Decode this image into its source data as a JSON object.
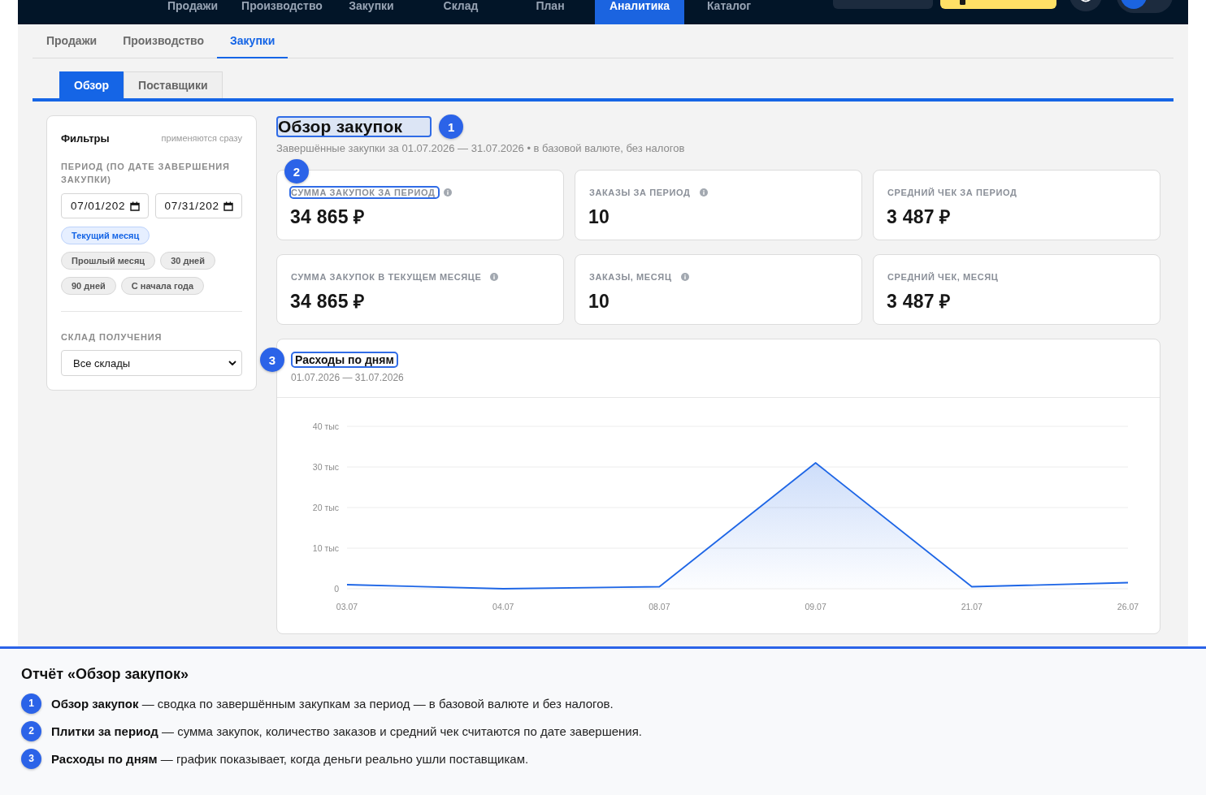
{
  "top_nav": {
    "tabs": [
      {
        "label": "Продажи",
        "selected": false
      },
      {
        "label": "Производство",
        "selected": false
      },
      {
        "label": "Закупки",
        "selected": false
      },
      {
        "label": "Склад",
        "selected": false
      },
      {
        "label": "План",
        "selected": false
      },
      {
        "label": "Аналитика",
        "selected": true
      },
      {
        "label": "Каталог",
        "selected": false
      }
    ]
  },
  "section_tabs": [
    {
      "label": "Продажи",
      "selected": false
    },
    {
      "label": "Производство",
      "selected": false
    },
    {
      "label": "Закупки",
      "selected": true
    }
  ],
  "report_tabs": [
    {
      "label": "Обзор",
      "selected": true
    },
    {
      "label": "Поставщики",
      "selected": false
    }
  ],
  "filters": {
    "title": "Фильтры",
    "hint": "применяются сразу",
    "period_label": "ПЕРИОД (ПО ДАТЕ ЗАВЕРШЕНИЯ ЗАКУПКИ)",
    "date_from": {
      "value": "07/01/202"
    },
    "date_to": {
      "value": "07/31/202"
    },
    "presets": [
      {
        "label": "Текущий месяц",
        "selected": true
      },
      {
        "label": "Прошлый месяц",
        "selected": false
      },
      {
        "label": "30 дней",
        "selected": false
      },
      {
        "label": "90 дней",
        "selected": false
      },
      {
        "label": "С начала года",
        "selected": false
      }
    ],
    "warehouse_label": "СКЛАД ПОЛУЧЕНИЯ",
    "warehouse_select": {
      "value": "Все склады"
    }
  },
  "overview": {
    "title": {
      "text": "Обзор закупок",
      "highlighted": true,
      "marker": "1"
    },
    "subtitle": "Завершённые закупки за 01.07.2026 — 31.07.2026 • в базовой валюте, без налогов",
    "kpis": [
      {
        "label": "СУММА ЗАКУПОК ЗА ПЕРИОД",
        "value": "34 865 ₽",
        "info": true,
        "highlighted": true,
        "marker": "2"
      },
      {
        "label": "ЗАКАЗЫ ЗА ПЕРИОД",
        "value": "10",
        "info": true,
        "highlighted": false
      },
      {
        "label": "СРЕДНИЙ ЧЕК ЗА ПЕРИОД",
        "value": "3 487 ₽",
        "info": false,
        "highlighted": false
      },
      {
        "label": "СУММА ЗАКУПОК В ТЕКУЩЕМ МЕСЯЦЕ",
        "value": "34 865 ₽",
        "info": true,
        "highlighted": false
      },
      {
        "label": "ЗАКАЗЫ, МЕСЯЦ",
        "value": "10",
        "info": true,
        "highlighted": false
      },
      {
        "label": "СРЕДНИЙ ЧЕК, МЕСЯЦ",
        "value": "3 487 ₽",
        "info": false,
        "highlighted": false
      }
    ]
  },
  "spend_chart": {
    "title": {
      "text": "Расходы по дням",
      "highlighted": true,
      "marker": "3"
    },
    "subtitle": "01.07.2026 — 31.07.2026",
    "chart_data": {
      "type": "area",
      "categories": [
        "03.07",
        "04.07",
        "08.07",
        "09.07",
        "21.07",
        "26.07"
      ],
      "values": [
        1,
        0,
        0.5,
        31,
        0.5,
        1.5
      ],
      "ylim": [
        0,
        40
      ],
      "yticks": [
        {
          "value": 0,
          "label": "0"
        },
        {
          "value": 10,
          "label": "10 тыс"
        },
        {
          "value": 20,
          "label": "20 тыс"
        },
        {
          "value": 30,
          "label": "30 тыс"
        },
        {
          "value": 40,
          "label": "40 тыс"
        }
      ],
      "grid": true
    }
  },
  "guide": {
    "title": "Отчёт «Обзор закупок»",
    "items": [
      {
        "number": "1",
        "text": "**Обзор закупок** — сводка по завершённым закупкам за период — в базовой валюте и без налогов."
      },
      {
        "number": "2",
        "text": "**Плитки за период** — сумма закупок, количество заказов и средний чек считаются по дате завершения."
      },
      {
        "number": "3",
        "text": "**Расходы по дням** — график показывает, когда деньги реально ушли поставщикам."
      }
    ]
  }
}
